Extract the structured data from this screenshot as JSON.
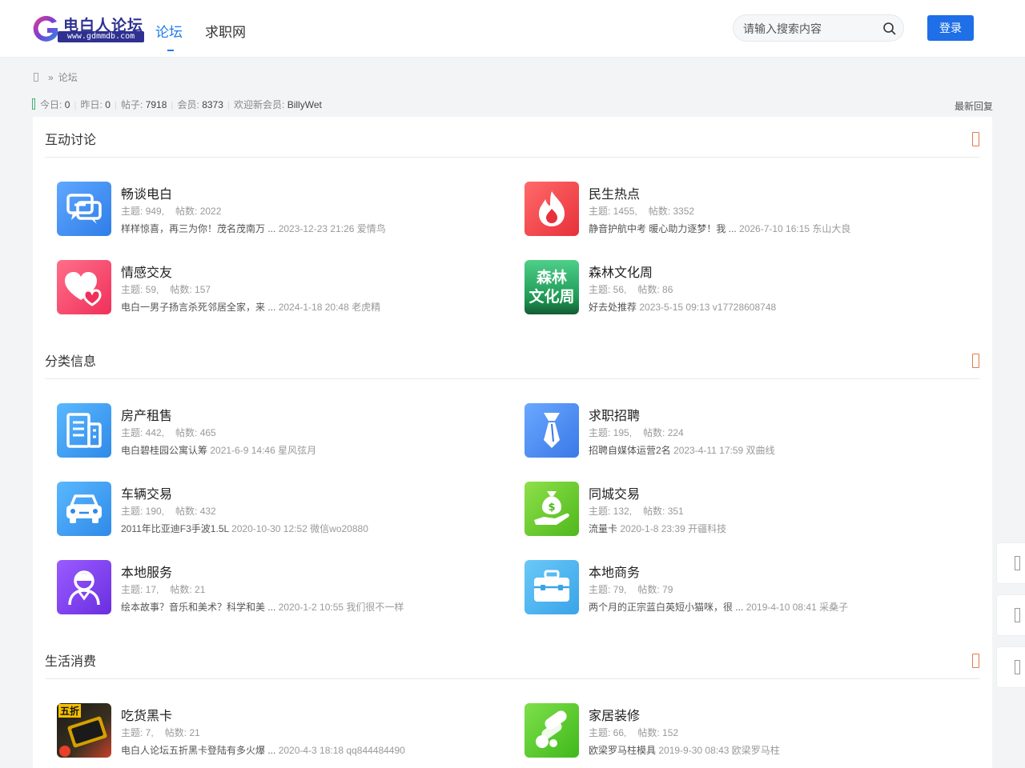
{
  "header": {
    "logo_title": "电白人论坛",
    "logo_url": "www.gdmmdb.com",
    "nav": [
      {
        "label": "论坛"
      },
      {
        "label": "求职网"
      }
    ],
    "search_placeholder": "请输入搜索内容",
    "login_label": "登录"
  },
  "breadcrumb": {
    "sep": "»",
    "current": "论坛"
  },
  "stats": {
    "today_label": "今日:",
    "today": "0",
    "yesterday_label": "昨日:",
    "yesterday": "0",
    "posts_label": "帖子:",
    "posts": "7918",
    "members_label": "会员:",
    "members": "8373",
    "welcome_label": "欢迎新会员:",
    "newest_member": "BillyWet",
    "latest_reply": "最新回复"
  },
  "colors": {
    "accent": "#1e7be9",
    "login": "#1e6fe8",
    "collapse": "#e27a4e"
  },
  "sections": [
    {
      "title": "互动讨论",
      "forums": [
        {
          "name": "畅谈电白",
          "icon": "chat-bubbles-icon",
          "topics": "主题: 949,",
          "posts": "帖数: 2022",
          "last": "样样惊喜，再三为你！茂名茂南万 ...",
          "meta": "2023-12-23 21:26 爱情鸟"
        },
        {
          "name": "民生热点",
          "icon": "flame-icon",
          "topics": "主题: 1455,",
          "posts": "帖数: 3352",
          "last": "静音护航中考 暖心助力逐梦！我 ...",
          "meta": "2026-7-10 16:15 东山大良"
        },
        {
          "name": "情感交友",
          "icon": "hearts-icon",
          "topics": "主题: 59,",
          "posts": "帖数: 157",
          "last": "电白一男子扬言杀死邻居全家，来 ...",
          "meta": "2024-1-18 20:48 老虎精"
        },
        {
          "name": "森林文化周",
          "icon": "forest-culture-week-icon",
          "icon_text": [
            "森林",
            "文化周"
          ],
          "topics": "主题: 56,",
          "posts": "帖数: 86",
          "last": "好去处推荐",
          "meta": "2023-5-15 09:13 v17728608748"
        }
      ]
    },
    {
      "title": "分类信息",
      "forums": [
        {
          "name": "房产租售",
          "icon": "building-icon",
          "topics": "主题: 442,",
          "posts": "帖数: 465",
          "last": "电白碧桂园公寓认筹",
          "meta": "2021-6-9 14:46 星风弦月"
        },
        {
          "name": "求职招聘",
          "icon": "necktie-icon",
          "topics": "主题: 195,",
          "posts": "帖数: 224",
          "last": "招聘自媒体运营2名",
          "meta": "2023-4-11 17:59 双曲线"
        },
        {
          "name": "车辆交易",
          "icon": "car-icon",
          "topics": "主题: 190,",
          "posts": "帖数: 432",
          "last": "2011年比亚迪F3手波1.5L",
          "meta": "2020-10-30 12:52 微信wo20880"
        },
        {
          "name": "同城交易",
          "icon": "money-bag-hand-icon",
          "topics": "主题: 132,",
          "posts": "帖数: 351",
          "last": "流量卡",
          "meta": "2020-1-8 23:39 开疆科技"
        },
        {
          "name": "本地服务",
          "icon": "service-person-icon",
          "topics": "主题: 17,",
          "posts": "帖数: 21",
          "last": "绘本故事？音乐和美术？科学和美 ...",
          "meta": "2020-1-2 10:55 我们很不一样"
        },
        {
          "name": "本地商务",
          "icon": "briefcase-icon",
          "topics": "主题: 79,",
          "posts": "帖数: 79",
          "last": "两个月的正宗蓝白英短小猫咪，很 ...",
          "meta": "2019-4-10 08:41 采桑子"
        }
      ]
    },
    {
      "title": "生活消费",
      "forums": [
        {
          "name": "吃货黑卡",
          "icon": "foodie-black-card-icon",
          "icon_text": [
            "五折"
          ],
          "topics": "主题: 7,",
          "posts": "帖数: 21",
          "last": "电白人论坛五折黑卡登陆有多火爆 ...",
          "meta": "2020-4-3 18:18 qq844484490"
        },
        {
          "name": "家居装修",
          "icon": "paint-roller-icon",
          "topics": "主题: 66,",
          "posts": "帖数: 152",
          "last": "欧梁罗马柱模具",
          "meta": "2019-9-30 08:43 欧梁罗马柱"
        }
      ]
    }
  ]
}
